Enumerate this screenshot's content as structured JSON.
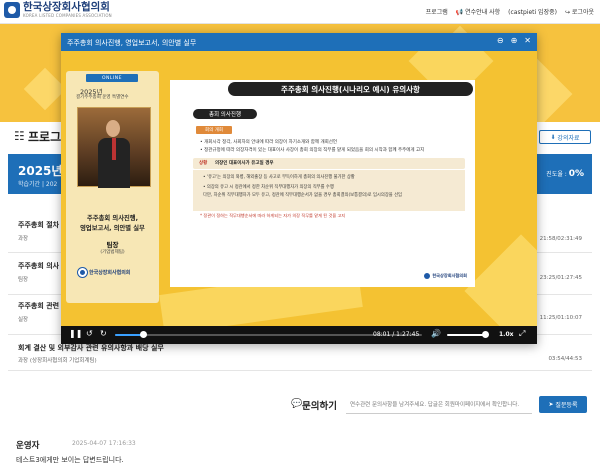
{
  "site": {
    "logo_name": "한국상장회사협의회",
    "logo_sub": "KOREA LISTED COMPANIES ASSOCIATION",
    "nav": [
      "프로그램",
      "연수안내 사항",
      "(castpieti 입장중)",
      "로그아웃"
    ]
  },
  "page": {
    "title": "프로그",
    "materials_button": "강의자료"
  },
  "course": {
    "title": "2025년",
    "period_label": "학습기간 | 202",
    "progress_label": "진도율 :",
    "progress_value": "0%"
  },
  "lectures": [
    {
      "title": "주주총회 절차",
      "sub": "과장",
      "time": "21:58/02:31:49"
    },
    {
      "title": "주주총회 의사",
      "sub": "팀장",
      "time": "23:25/01:27:45"
    },
    {
      "title": "주주총회 관련",
      "sub": "실장",
      "time": "11:25/01:10:07"
    },
    {
      "title": "회계 결산 및 외부감사 관련 유의사항과 배당 실무",
      "sub": "과장 (상장회사협의회 기업회계팀)",
      "time": "03:54/44:53"
    }
  ],
  "qa": {
    "title": "문의하기",
    "placeholder": "연수관련 문의사항을 남겨주세요. 답글은 회원마이페이지에서 확인합니다.",
    "submit": "질문등록"
  },
  "comment": {
    "author": "운영자",
    "date": "2025-04-07 17:16:33",
    "text": "테스트3에게만 보이는 답변드립니다."
  },
  "player": {
    "title": "주주총회 의사진행, 영업보고서, 의안별 실무",
    "left_card": {
      "badge": "ONLINE",
      "year": "2025년",
      "subtitle": "결기주주총회 운영 특별연수",
      "topic_line1": "주주총회 의사진행,",
      "topic_line2": "영업보고서, 의안별 실무",
      "speaker": "팀장",
      "affiliation": "(기업법제팀)",
      "logo": "한국상장회사협의회"
    },
    "slide": {
      "title": "주주총회 의사진행(시나리오 예시) 유의사항",
      "section": "총회 의사진행",
      "tag": "회의 개회",
      "bullets": [
        "• 개회시각 정각, 사회자의 안내에 따라 의장이 자기소개와 함께 개회선언",
        "• 정관규정에 따라 의장자격이 있는 대표이사 사장이 총회 의장의 직무를 맡게 되었음을 회의 시작과 함께 주주에게 고지"
      ],
      "case_label": "상황",
      "case_text": "의장인 대표이사가 유고일 경우",
      "box_lines": [
        "• '유고'는 의장의 와병, 해외출장 등 사고로 부득이하게 총회의 의사진행 불가한 상황",
        "• 의장의 유고 시 정관에서 정한 차순위 직무대행자가 의장의 직무를 수행",
        "  다만, 차순위 직무대행자가 모두 유고, 정관에 직무대행순서가 없을 경우 총회결의(보통결의)로 임시의장을 선임"
      ],
      "note": "* 정관이 정하는 직무대행순서에 따라 하게되는 자가 의장 직무를 맡게 된 것을 고지",
      "logo": "한국상장회사협의회"
    },
    "time_current": "08:01",
    "time_total": "1:27:45",
    "rate": "1.0x",
    "progress_fraction": 0.092
  }
}
